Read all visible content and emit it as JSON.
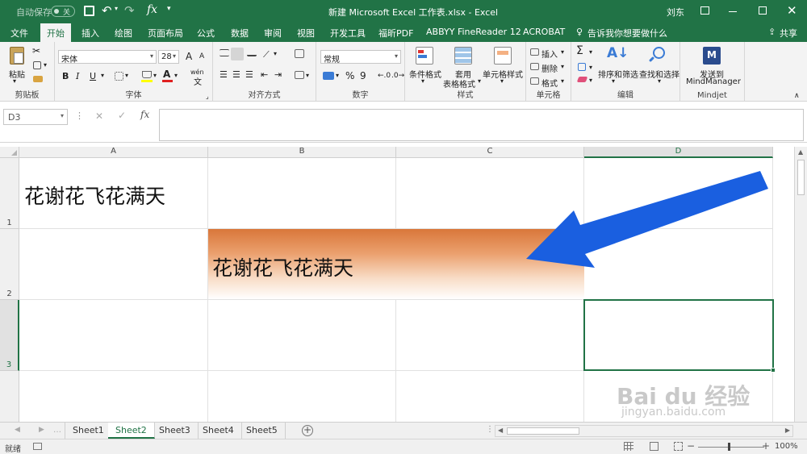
{
  "title_bar": {
    "autosave_label": "自动保存",
    "autosave_state": "关",
    "fx_label": "fx",
    "window_title": "新建 Microsoft Excel 工作表.xlsx  -  Excel",
    "user_name": "刘东"
  },
  "menu": {
    "tabs": [
      "文件",
      "开始",
      "插入",
      "绘图",
      "页面布局",
      "公式",
      "数据",
      "审阅",
      "视图",
      "开发工具",
      "福昕PDF",
      "ABBYY FineReader 12",
      "ACROBAT"
    ],
    "active_tab": "开始",
    "tell_me": "告诉我你想要做什么",
    "share": "共享"
  },
  "ribbon": {
    "clipboard": {
      "paste": "粘贴",
      "label": "剪贴板"
    },
    "font": {
      "name": "宋体",
      "size": "28",
      "bold": "B",
      "italic": "I",
      "underline": "U",
      "label": "字体",
      "wen": "wén",
      "grow": "A",
      "shrink": "A"
    },
    "alignment": {
      "label": "对齐方式"
    },
    "number": {
      "format": "常规",
      "percent": "%",
      "comma": "9",
      "label": "数字"
    },
    "styles": {
      "conditional": "条件格式",
      "table_format_1": "套用",
      "table_format_2": "表格格式",
      "cell_styles": "单元格样式",
      "label": "样式"
    },
    "cells": {
      "insert": "插入",
      "delete": "删除",
      "format": "格式",
      "label": "单元格"
    },
    "editing": {
      "sum": "Σ",
      "sort_filter": "排序和筛选",
      "find_select": "查找和选择",
      "label": "编辑"
    },
    "mindjet": {
      "send_to": "发送到",
      "mindmanager": "MindManager",
      "label": "Mindjet"
    }
  },
  "formula_bar": {
    "name_box": "D3",
    "fx": "fx",
    "formula": ""
  },
  "grid": {
    "columns": [
      "A",
      "B",
      "C",
      "D"
    ],
    "rows": [
      "1",
      "2",
      "3"
    ],
    "cell_a1": "花谢花飞花满天",
    "cell_b2": "花谢花飞花满天",
    "selected_cell": "D3"
  },
  "sheet_tabs": {
    "tabs": [
      "Sheet1",
      "Sheet2",
      "Sheet3",
      "Sheet4",
      "Sheet5"
    ],
    "active": "Sheet2",
    "add": "+"
  },
  "status_bar": {
    "ready": "就绪",
    "zoom": "100%",
    "minus": "−",
    "plus": "+"
  },
  "colors": {
    "excel_green": "#217346",
    "gradient_orange": "#d9773a",
    "arrow_blue": "#1a5fe0"
  },
  "watermark": {
    "brand": "Bai  du 经验",
    "url": "jingyan.baidu.com"
  }
}
